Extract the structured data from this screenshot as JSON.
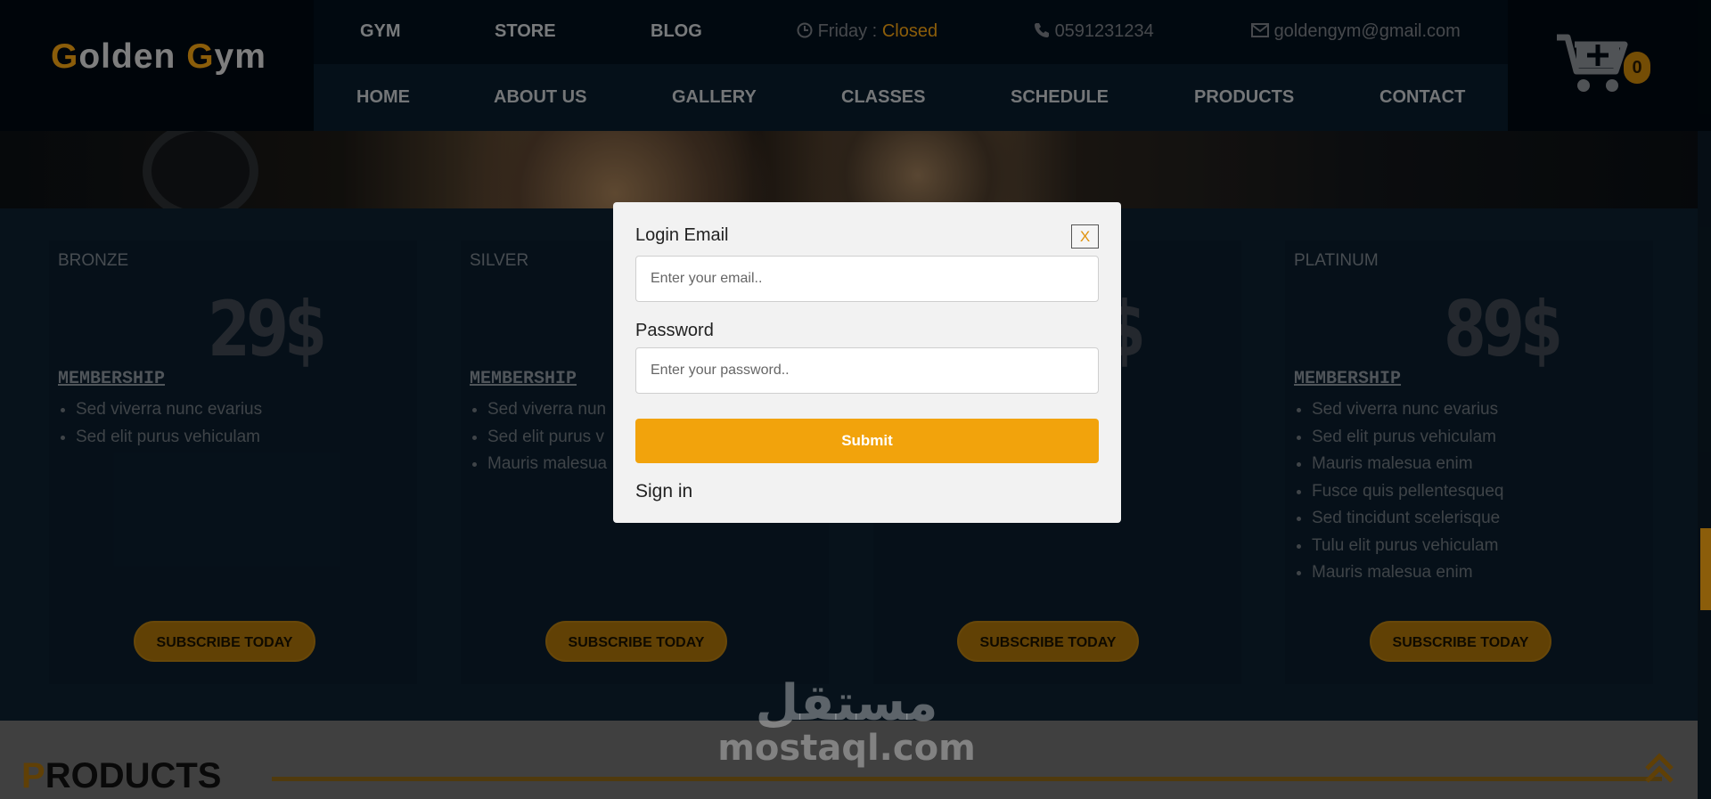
{
  "logo": {
    "g1": "G",
    "rest1": "olden ",
    "g2": "G",
    "rest2": "ym"
  },
  "topbar": {
    "gym": "GYM",
    "store": "STORE",
    "blog": "BLOG",
    "hours_day": "Friday : ",
    "hours_status": "Closed",
    "phone": "0591231234",
    "email": "goldengym@gmail.com"
  },
  "nav": [
    "HOME",
    "ABOUT US",
    "GALLERY",
    "CLASSES",
    "SCHEDULE",
    "PRODUCTS",
    "CONTACT"
  ],
  "cart": {
    "count": "0"
  },
  "plans": [
    {
      "name": "BRONZE",
      "label": "MEMBERSHIP",
      "price": "29$",
      "features": [
        "Sed viverra nunc evarius",
        "Sed elit purus vehiculam"
      ],
      "button": "SUBSCRIBE TODAY"
    },
    {
      "name": "SILVER",
      "label": "MEMBERSHIP",
      "price": "",
      "features": [
        "Sed viverra nun",
        "Sed elit purus v",
        "Mauris malesua"
      ],
      "button": "SUBSCRIBE TODAY"
    },
    {
      "name": "",
      "label": "",
      "price": "$",
      "features": [],
      "button": "SUBSCRIBE TODAY"
    },
    {
      "name": "PLATINUM",
      "label": "MEMBERSHIP",
      "price": "89$",
      "features": [
        "Sed viverra nunc evarius",
        "Sed elit purus vehiculam",
        "Mauris malesua enim",
        "Fusce quis pellentesqueq",
        "Sed tincidunt scelerisque",
        "Tulu elit purus vehiculam",
        "Mauris malesua enim"
      ],
      "button": "SUBSCRIBE TODAY"
    }
  ],
  "products": {
    "first": "P",
    "rest": "RODUCTS"
  },
  "watermark": {
    "arabic": "مستقل",
    "latin": "mostaql.com"
  },
  "modal": {
    "email_label": "Login Email",
    "email_placeholder": "Enter your email..",
    "password_label": "Password",
    "password_placeholder": "Enter your password..",
    "submit": "Submit",
    "signin": "Sign in",
    "close": "X"
  },
  "colors": {
    "accent": "#f2a30c",
    "dark": "#07141f"
  }
}
